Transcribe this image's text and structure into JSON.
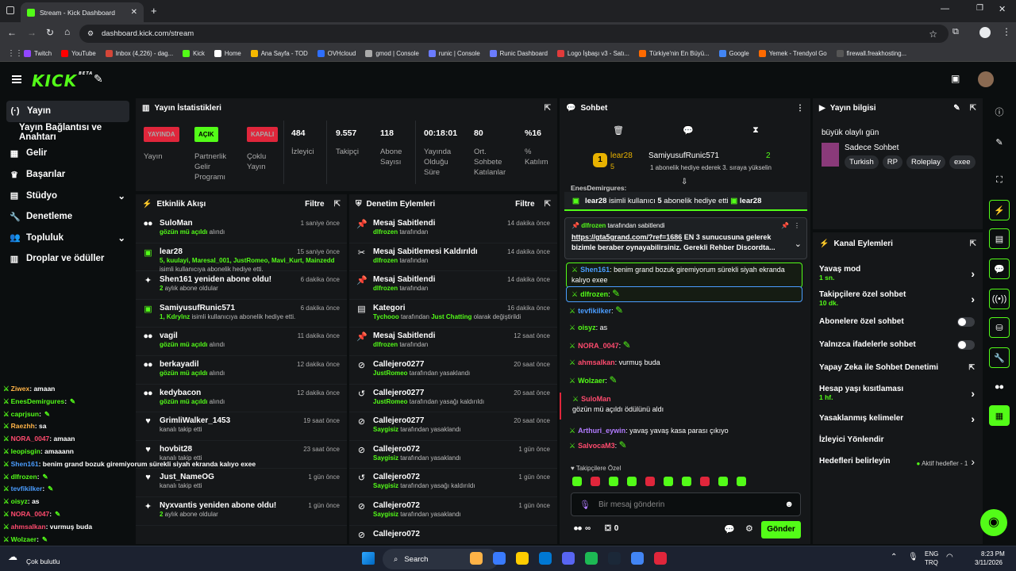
{
  "browser": {
    "tab_title": "Stream - Kick Dashboard",
    "url": "dashboard.kick.com/stream",
    "bookmarks": [
      "Twitch",
      "YouTube",
      "Inbox (4,226) - dag...",
      "Kick",
      "Home",
      "Ana Sayfa - TOD",
      "OVHcloud",
      "gmod | Console",
      "runic | Console",
      "Runic Dashboard",
      "Logo İşbaşı v3 - Satı...",
      "Türkiye'nin En Büyü...",
      "Google",
      "Yemek - Trendyol Go",
      "firewall.freakhosting..."
    ]
  },
  "brand": {
    "logo": "KICK",
    "beta": "BETA",
    "accent": "#53fc18"
  },
  "sidebar": {
    "items": [
      {
        "label": "Yayın",
        "icon": "broadcast-icon"
      },
      {
        "label": "Yayın Bağlantısı ve Anahtarı",
        "icon": ""
      },
      {
        "label": "Gelir",
        "icon": "money-icon"
      },
      {
        "label": "Başarılar",
        "icon": "trophy-icon"
      },
      {
        "label": "Stüdyo",
        "icon": "studio-icon"
      },
      {
        "label": "Denetleme",
        "icon": "wrench-icon"
      },
      {
        "label": "Topluluk",
        "icon": "community-icon"
      },
      {
        "label": "Droplar ve ödüller",
        "icon": "gift-icon"
      }
    ]
  },
  "stats": {
    "title": "Yayın İstatistikleri",
    "badges": {
      "live": "YAYINDA",
      "live_label": "Yayın",
      "partner": "AÇIK",
      "partner_label": "Partnerlik Gelir Programı",
      "multi": "KAPALI",
      "multi_label": "Çoklu Yayın"
    },
    "viewers": "484",
    "viewers_label": "İzleyici",
    "followers": "9.557",
    "followers_label": "Takipçi",
    "subs": "118",
    "subs_label": "Abone Sayısı",
    "uptime": "00:18:01",
    "uptime_label": "Yayında Olduğu Süre",
    "chatters": "80",
    "chatters_label": "Ort. Sohbete Katılanlar",
    "engagement": "%16",
    "engagement_label": "% Katılım"
  },
  "activity": {
    "title": "Etkinlik Akışı",
    "filter": "Filtre",
    "items": [
      {
        "icon": "drop-icon",
        "name": "SuloMan",
        "time": "1 saniye önce",
        "sub_green": "gözün mü açıldı",
        "sub": " alındı"
      },
      {
        "icon": "gift-icon",
        "name": "lear28",
        "time": "15 saniye önce",
        "sub_green": "5, kuulayi, Maresal_001, JustRomeo, Mavi_Kurt, Mainzedd",
        "sub": " isimli kullanıcıya abonelik hediye etti."
      },
      {
        "icon": "sparkle-icon",
        "name": "Shen161 yeniden abone oldu!",
        "time": "6 dakika önce",
        "sub_green": "2",
        "sub": " aylık abone oldular"
      },
      {
        "icon": "gift-icon",
        "name": "SamiyusufRunic571",
        "time": "6 dakika önce",
        "sub_green": "1, Kdrylnz",
        "sub": " isimli kullanıcıya abonelik hediye etti."
      },
      {
        "icon": "drop-icon",
        "name": "vagil",
        "time": "11 dakika önce",
        "sub_green": "gözün mü açıldı",
        "sub": " alındı"
      },
      {
        "icon": "drop-icon",
        "name": "berkayadil",
        "time": "12 dakika önce",
        "sub_green": "gözün mü açıldı",
        "sub": " alındı"
      },
      {
        "icon": "drop-icon",
        "name": "kedybacon",
        "time": "12 dakika önce",
        "sub_green": "gözün mü açıldı",
        "sub": " alındı"
      },
      {
        "icon": "heart-icon",
        "name": "GrimliWalker_1453",
        "time": "19 saat önce",
        "sub_green": "",
        "sub": "kanalı takip etti"
      },
      {
        "icon": "heart-icon",
        "name": "hovbit28",
        "time": "23 saat önce",
        "sub_green": "",
        "sub": "kanalı takip etti"
      },
      {
        "icon": "heart-icon",
        "name": "Just_NameOG",
        "time": "1 gün önce",
        "sub_green": "",
        "sub": "kanalı takip etti"
      },
      {
        "icon": "sparkle-icon",
        "name": "Nyxvantis yeniden abone oldu!",
        "time": "1 gün önce",
        "sub_green": "2",
        "sub": " aylık abone oldular"
      }
    ]
  },
  "moderation": {
    "title": "Denetim Eylemleri",
    "filter": "Filtre",
    "items": [
      {
        "icon": "pin-icon",
        "name": "Mesaj Sabitlendi",
        "time": "14 dakika önce",
        "sub_green": "dlfrozen",
        "sub": " tarafından"
      },
      {
        "icon": "unpin-icon",
        "name": "Mesaj Sabitlemesi Kaldırıldı",
        "time": "14 dakika önce",
        "sub_green": "dlfrozen",
        "sub": " tarafından"
      },
      {
        "icon": "pin-icon",
        "name": "Mesaj Sabitlendi",
        "time": "14 dakika önce",
        "sub_green": "dlfrozen",
        "sub": " tarafından"
      },
      {
        "icon": "category-icon",
        "name": "Kategori",
        "time": "16 dakika önce",
        "sub_green": "Tychooo",
        "sub": " tarafından ",
        "sub_green2": "Just Chatting",
        "sub2": " olarak değiştirildi"
      },
      {
        "icon": "pin-icon",
        "name": "Mesaj Sabitlendi",
        "time": "12 saat önce",
        "sub_green": "dlfrozen",
        "sub": " tarafından"
      },
      {
        "icon": "ban-icon",
        "name": "Callejero0277",
        "time": "20 saat önce",
        "sub_green": "JustRomeo",
        "sub": " tarafından yasaklandı"
      },
      {
        "icon": "unban-icon",
        "name": "Callejero0277",
        "time": "20 saat önce",
        "sub_green": "JustRomeo",
        "sub": " tarafından yasağı kaldırıldı"
      },
      {
        "icon": "ban-icon",
        "name": "Callejero0277",
        "time": "20 saat önce",
        "sub_green": "Saygisiz",
        "sub": " tarafından yasaklandı"
      },
      {
        "icon": "ban-icon",
        "name": "Callejero072",
        "time": "1 gün önce",
        "sub_green": "Saygisiz",
        "sub": " tarafından yasaklandı"
      },
      {
        "icon": "unban-icon",
        "name": "Callejero072",
        "time": "1 gün önce",
        "sub_green": "Saygisiz",
        "sub": " tarafından yasağı kaldırıldı"
      },
      {
        "icon": "ban-icon",
        "name": "Callejero072",
        "time": "1 gün önce",
        "sub_green": "Saygisiz",
        "sub": " tarafından yasaklandı"
      },
      {
        "icon": "ban-icon",
        "name": "Callejero072",
        "time": "",
        "sub_green": "",
        "sub": ""
      }
    ]
  },
  "chat": {
    "title": "Sohbet",
    "top_gifter": {
      "rank": "1",
      "name": "lear28",
      "count": "5",
      "name2": "SamiyusufRunic571",
      "count2": "2",
      "note": "1 abonelik hediye ederek 3. sıraya yükselin"
    },
    "clipped_name": "EnesDemirgures:",
    "gift_banner": {
      "text1": "lear28",
      "text2": " isimli kullanıcı ",
      "count": "5",
      "text3": " abonelik hediye etti",
      "text4": "lear28"
    },
    "pinned": {
      "by": "dlfrozen",
      "by_suffix": " tarafından sabitlendi",
      "link": "https://gta5grand.com/?ref=1686",
      "text": " EN 3 sunucusuna gelerek bizimle beraber oynayabilirsiniz. Gerekli Rehber Discordta..."
    },
    "messages": [
      {
        "user": "Shen161",
        "color": "#4a9dff",
        "text": "benim grand bozuk giremiyorum sürekli siyah ekranda kalıyo exee",
        "boxed": true
      },
      {
        "user": "dlfrozen",
        "color": "#53fc18",
        "text": "",
        "boxed": true
      },
      {
        "user": "tevfikilker",
        "color": "#4a9dff",
        "text": ""
      },
      {
        "user": "oisyz",
        "color": "#53fc18",
        "text": "as"
      },
      {
        "user": "NORA_0047",
        "color": "#ff4b6e",
        "text": ""
      },
      {
        "user": "ahmsalkan",
        "color": "#ff4b6e",
        "text": "vurmuş buda"
      },
      {
        "user": "Wolzaer",
        "color": "#53fc18",
        "text": ""
      },
      {
        "user": "SuloMan",
        "color": "#ff4b6e",
        "text": "gözün mü açıldı ödülünü aldı",
        "reward": true
      },
      {
        "user": "Arthuri_eywin",
        "color": "#b27cff",
        "text": "yavaş yavaş kasa parası çıkıyo"
      },
      {
        "user": "SalvocaM3",
        "color": "#ff4b6e",
        "text": ""
      }
    ],
    "emote_label": "Takipçilere Özel",
    "input_placeholder": "Bir mesaj gönderin",
    "points": "∞",
    "chest": "0",
    "send": "Gönder"
  },
  "stream_info": {
    "title": "Yayın bilgisi",
    "stream_title": "büyük olaylı gün",
    "category": "Sadece Sohbet",
    "tags": [
      "Turkish",
      "RP",
      "Roleplay",
      "exee"
    ]
  },
  "channel_actions": {
    "title": "Kanal Eylemleri",
    "items": [
      {
        "label": "Yavaş mod",
        "value": "1 sn.",
        "control": "chevron"
      },
      {
        "label": "Takipçilere özel sohbet",
        "value": "10 dk.",
        "control": "chevron"
      },
      {
        "label": "Abonelere özel sohbet",
        "value": "",
        "control": "toggle"
      },
      {
        "label": "Yalnızca ifadelerle sohbet",
        "value": "",
        "control": "toggle"
      },
      {
        "label": "Yapay Zeka ile Sohbet Denetimi",
        "value": "",
        "control": "external"
      },
      {
        "label": "Hesap yaşı kısıtlaması",
        "value": "1 hf.",
        "control": "chevron"
      },
      {
        "label": "Yasaklanmış kelimeler",
        "value": "",
        "control": "chevron"
      },
      {
        "label": "İzleyici Yönlendir",
        "value": "",
        "control": ""
      },
      {
        "label": "Hedefleri belirleyin",
        "value": "",
        "control": "goal",
        "extra": "Aktif hedefler - 1"
      }
    ]
  },
  "overlay_chat": [
    {
      "user": "Ziwex",
      "color": "#ffb347",
      "text": ": amaan"
    },
    {
      "user": "EnesDemirgures",
      "color": "#53fc18",
      "text": ":"
    },
    {
      "user": "caprjsun",
      "color": "#53fc18",
      "text": ":"
    },
    {
      "user": "Raezhh",
      "color": "#ffb347",
      "text": ": sa"
    },
    {
      "user": "NORA_0047",
      "color": "#ff4b6e",
      "text": ": amaan"
    },
    {
      "user": "leopisgin",
      "color": "#53fc18",
      "text": ": amaaann"
    },
    {
      "user": "Shen161",
      "color": "#4a9dff",
      "text": ": benim grand bozuk giremiyorum sürekli siyah ekranda kalıyo exee"
    },
    {
      "user": "dlfrozen",
      "color": "#53fc18",
      "text": ":"
    },
    {
      "user": "tevfikilker",
      "color": "#4a9dff",
      "text": ":"
    },
    {
      "user": "oisyz",
      "color": "#53fc18",
      "text": ": as"
    },
    {
      "user": "NORA_0047",
      "color": "#ff4b6e",
      "text": ":"
    },
    {
      "user": "ahmsalkan",
      "color": "#ff4b6e",
      "text": ": vurmuş buda"
    },
    {
      "user": "Wolzaer",
      "color": "#53fc18",
      "text": ":"
    },
    {
      "user": "Arthuri_eywin",
      "color": "#b27cff",
      "text": ": yavaş yavaş kasa parası çıkıyo"
    }
  ],
  "taskbar": {
    "weather": "Çok bulutlu",
    "search": "Search",
    "lang1": "ENG",
    "lang2": "TRQ",
    "time": "8:23 PM",
    "date": "3/11/2026"
  }
}
